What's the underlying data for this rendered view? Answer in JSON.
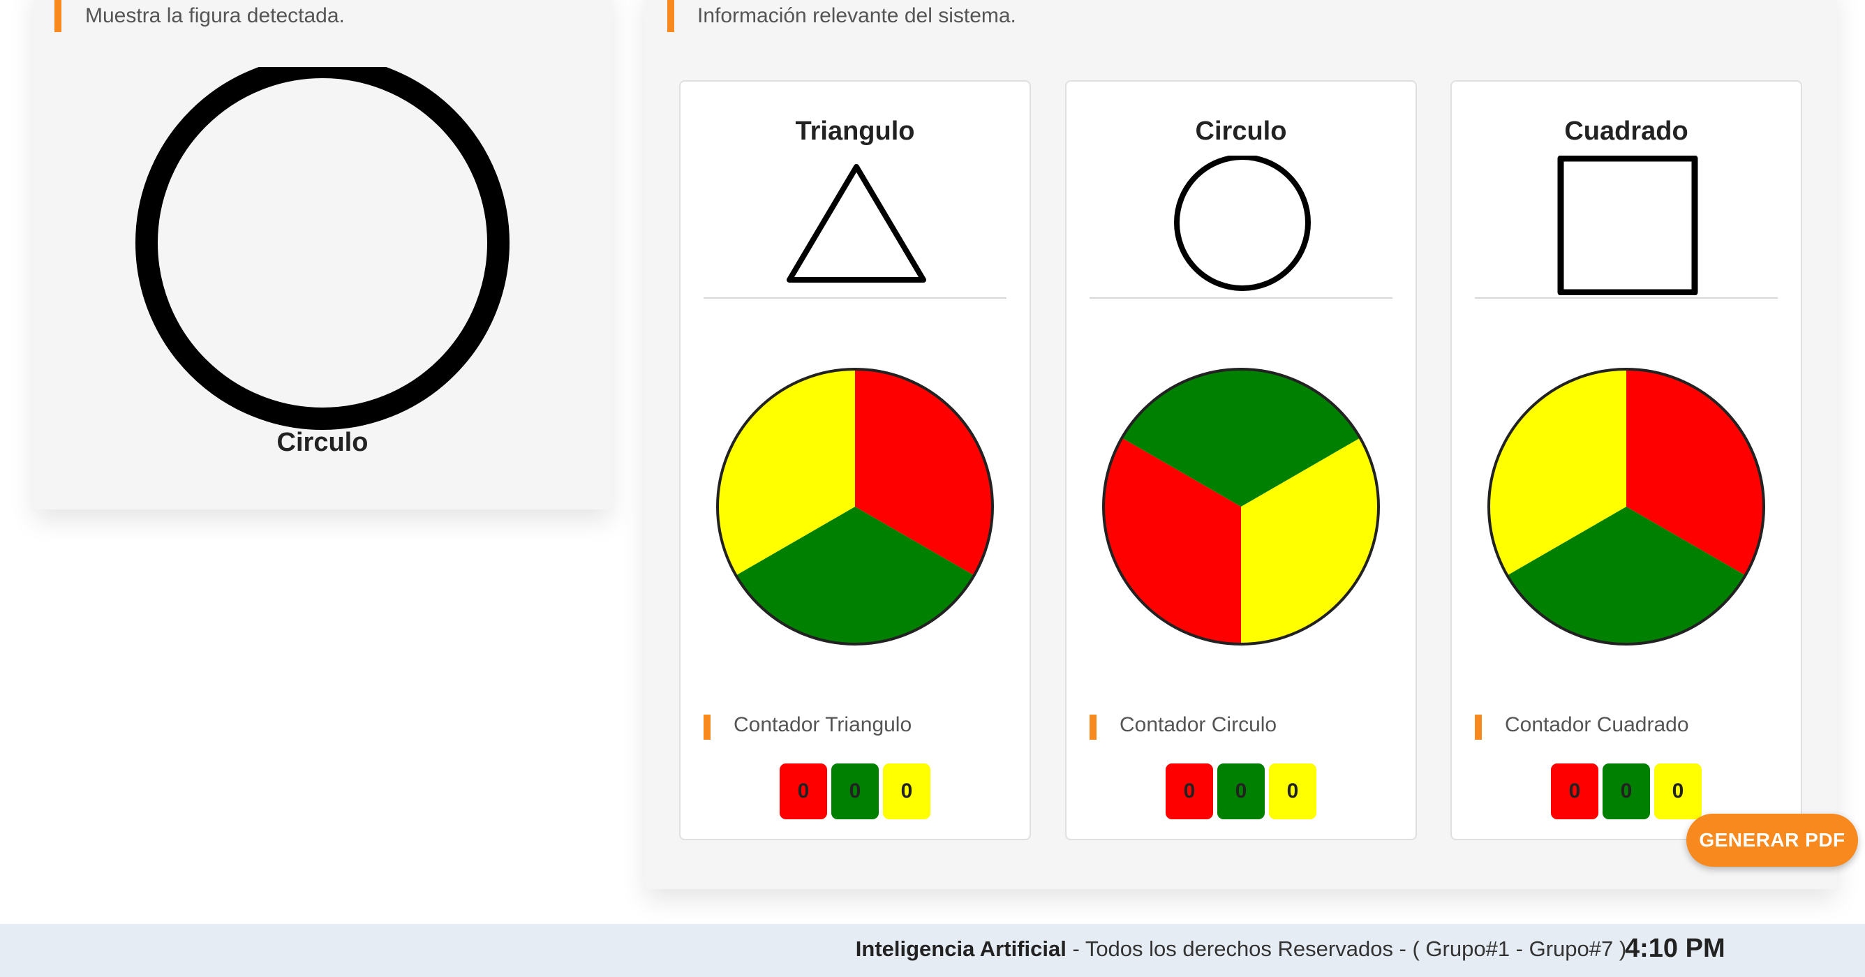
{
  "left_panel": {
    "subtitle": "Muestra la figura detectada.",
    "detected_shape": "circle-icon",
    "detected_label": "Circulo"
  },
  "right_panel": {
    "subtitle": "Información relevante del sistema.",
    "cards": [
      {
        "title": "Triangulo",
        "shape_icon": "triangle-icon",
        "counter_label": "Contador Triangulo",
        "counts": {
          "red": "0",
          "green": "0",
          "yellow": "0"
        },
        "pie_segment_colors": [
          "#ff0000",
          "#008000",
          "#ffff00"
        ],
        "pie_rotation_deg": 0
      },
      {
        "title": "Circulo",
        "shape_icon": "circle-icon",
        "counter_label": "Contador Circulo",
        "counts": {
          "red": "0",
          "green": "0",
          "yellow": "0"
        },
        "pie_segment_colors": [
          "#ffff00",
          "#ff0000",
          "#008000"
        ],
        "pie_rotation_deg": 60
      },
      {
        "title": "Cuadrado",
        "shape_icon": "square-icon",
        "counter_label": "Contador Cuadrado",
        "counts": {
          "red": "0",
          "green": "0",
          "yellow": "0"
        },
        "pie_segment_colors": [
          "#ff0000",
          "#008000",
          "#ffff00"
        ],
        "pie_rotation_deg": 0
      }
    ]
  },
  "pdf_button": {
    "label": "GENERAR PDF"
  },
  "footer": {
    "brand": "Inteligencia Artificial",
    "text": " - Todos los derechos Reservados - ( Grupo#1 - Grupo#7 )",
    "clock": "4:10 PM"
  },
  "colors": {
    "accent": "#f7891f",
    "red": "#ff0000",
    "green": "#008000",
    "yellow": "#ffff00",
    "footer_bg": "#e6ecf4"
  }
}
